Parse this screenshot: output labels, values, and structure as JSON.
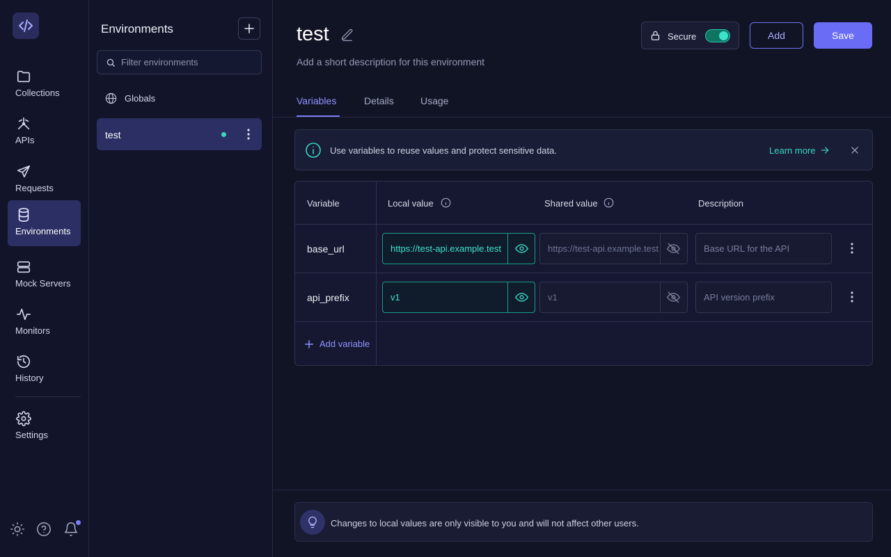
{
  "rail": {
    "items": [
      {
        "label": "Collections",
        "icon": "folder-icon"
      },
      {
        "label": "APIs",
        "icon": "apis-icon"
      },
      {
        "label": "Requests",
        "icon": "send-icon"
      },
      {
        "label": "Environments",
        "icon": "database-icon",
        "active": true
      },
      {
        "label": "Mock Servers",
        "icon": "server-icon"
      },
      {
        "label": "Monitors",
        "icon": "pulse-icon"
      },
      {
        "label": "History",
        "icon": "history-icon"
      },
      {
        "label": "Settings",
        "icon": "gear-icon"
      }
    ]
  },
  "env_panel": {
    "title": "Environments",
    "filter_placeholder": "Filter environments",
    "globals_label": "Globals",
    "selected_env": "test"
  },
  "main": {
    "title": "test",
    "description_placeholder": "Add a short description for this environment",
    "secure_label": "Secure",
    "secure_on": true,
    "add_button": "Add",
    "save_button": "Save",
    "tabs": [
      "Variables",
      "Details",
      "Usage"
    ],
    "active_tab": "Variables",
    "banner": {
      "text": "Use variables to reuse values and protect sensitive data.",
      "link": "Learn more"
    },
    "table": {
      "headers": [
        "Variable",
        "Local value",
        "Shared value",
        "Description"
      ],
      "rows": [
        {
          "variable": "base_url",
          "local": "https://test-api.example.test",
          "shared": "https://test-api.example.test",
          "description": "Base URL for the API"
        },
        {
          "variable": "api_prefix",
          "local": "v1",
          "shared": "v1",
          "description": "API version prefix"
        }
      ],
      "add_label": "Add variable"
    },
    "tip": "Changes to local values are only visible to you and will not affect other users."
  },
  "colors": {
    "accent": "#6a6cf6",
    "teal": "#3bd6c1",
    "background": "#111425"
  }
}
